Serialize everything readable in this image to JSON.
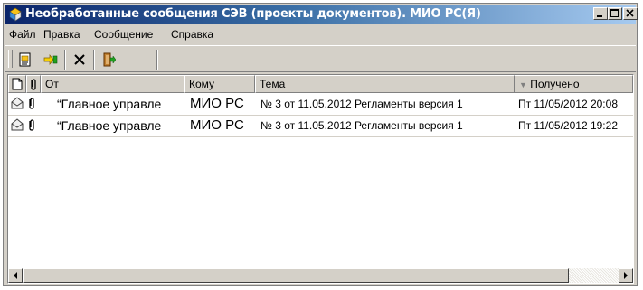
{
  "window": {
    "title": "Необработанные сообщения СЭВ (проекты документов). МИО РС(Я)"
  },
  "menu": [
    "Файл",
    "Правка",
    "Сообщение",
    "Справка"
  ],
  "columns": {
    "from": "От",
    "to": "Кому",
    "subject": "Тема",
    "received": "Получено"
  },
  "rows": [
    {
      "from": "“Главное управле",
      "to": "МИО РС",
      "subject": "№ 3 от 11.05.2012 Регламенты версия 1",
      "received": "Пт 11/05/2012 20:08"
    },
    {
      "from": "“Главное управле",
      "to": "МИО РС",
      "subject": "№ 3 от 11.05.2012 Регламенты версия 1",
      "received": "Пт 11/05/2012 19:22"
    }
  ],
  "icons": {
    "app": "app-icon",
    "toolbar": [
      "open-message-icon",
      "process-message-icon",
      "delete-icon",
      "exit-icon"
    ],
    "header": [
      "document-icon",
      "attachment-icon"
    ],
    "row": [
      "envelope-icon",
      "attachment-icon"
    ]
  },
  "colors": {
    "title_start": "#0a246a",
    "title_end": "#a6caf0",
    "chrome": "#d4d0c8"
  }
}
